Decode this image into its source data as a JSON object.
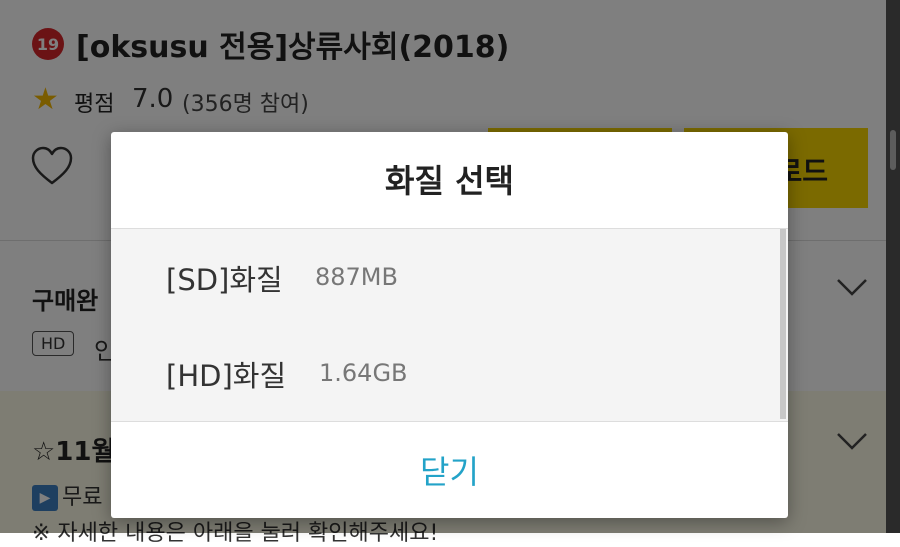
{
  "background": {
    "age_badge": "19",
    "title": "[oksusu 전용]상류사회(2018)",
    "rating": {
      "label": "평점",
      "value": "7.0",
      "count": "(356명 참여)"
    },
    "download_button_partial": "로드",
    "purchase": {
      "title_partial": "구매완",
      "badge": "HD",
      "sub_partial": "인"
    },
    "event": {
      "title_partial": "☆11월",
      "line_partial": "무료",
      "note_partial": "※ 자세한 내용은 아래을 눌러 확인해주세요!"
    }
  },
  "dialog": {
    "title": "화질 선택",
    "options": [
      {
        "label": "[SD]화질",
        "size": "887MB"
      },
      {
        "label": "[HD]화질",
        "size": "1.64GB"
      }
    ],
    "close_label": "닫기"
  },
  "colors": {
    "accent_yellow": "#f7d400",
    "age_badge_red": "#d7262b",
    "star_yellow": "#f5b800",
    "close_text_blue": "#23a3c8"
  },
  "icons": [
    "star-icon",
    "heart-icon",
    "chevron-down-icon",
    "play-icon"
  ]
}
